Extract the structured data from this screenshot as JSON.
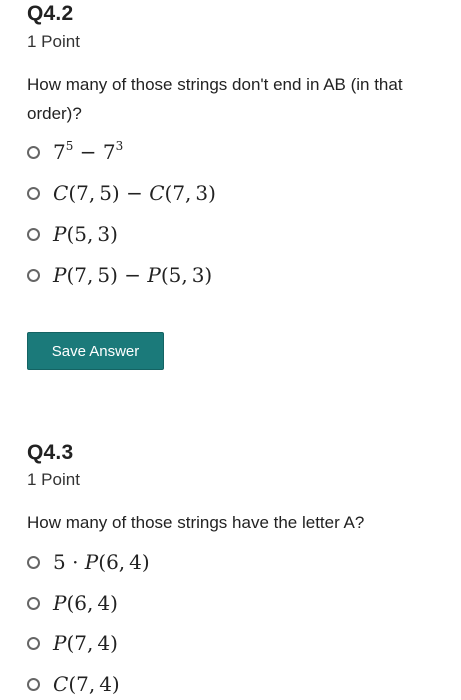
{
  "questions": [
    {
      "title": "Q4.2",
      "points": "1 Point",
      "prompt": "How many of those strings don't end in AB (in that order)?",
      "options": [
        "7^5 − 7^3",
        "C(7,5) − C(7,3)",
        "P(5,3)",
        "P(7,5) − P(5,3)"
      ]
    },
    {
      "title": "Q4.3",
      "points": "1 Point",
      "prompt": "How many of those strings have the letter A?",
      "options": [
        "5 · P(6,4)",
        "P(6,4)",
        "P(7,4)",
        "C(7,4)"
      ]
    }
  ],
  "save_button": {
    "label": "Save Answer"
  },
  "colors": {
    "save_button_bg": "#1b7a7a"
  }
}
